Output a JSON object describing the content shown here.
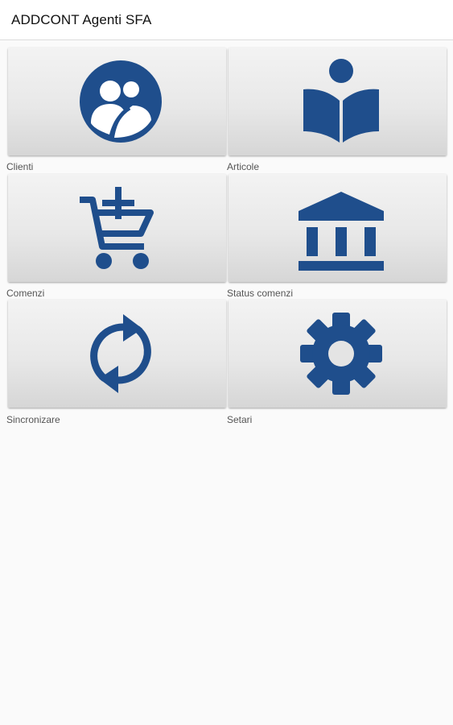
{
  "app": {
    "title": "ADDCONT Agenti SFA",
    "accent_color": "#1f4e8c"
  },
  "menu": [
    {
      "label": "Clienti",
      "icon": "clients-icon"
    },
    {
      "label": "Articole",
      "icon": "book-reader-icon"
    },
    {
      "label": "Comenzi",
      "icon": "add-to-cart-icon"
    },
    {
      "label": "Status comenzi",
      "icon": "bank-icon"
    },
    {
      "label": "Sincronizare",
      "icon": "sync-icon"
    },
    {
      "label": "Setari",
      "icon": "gear-icon"
    }
  ]
}
